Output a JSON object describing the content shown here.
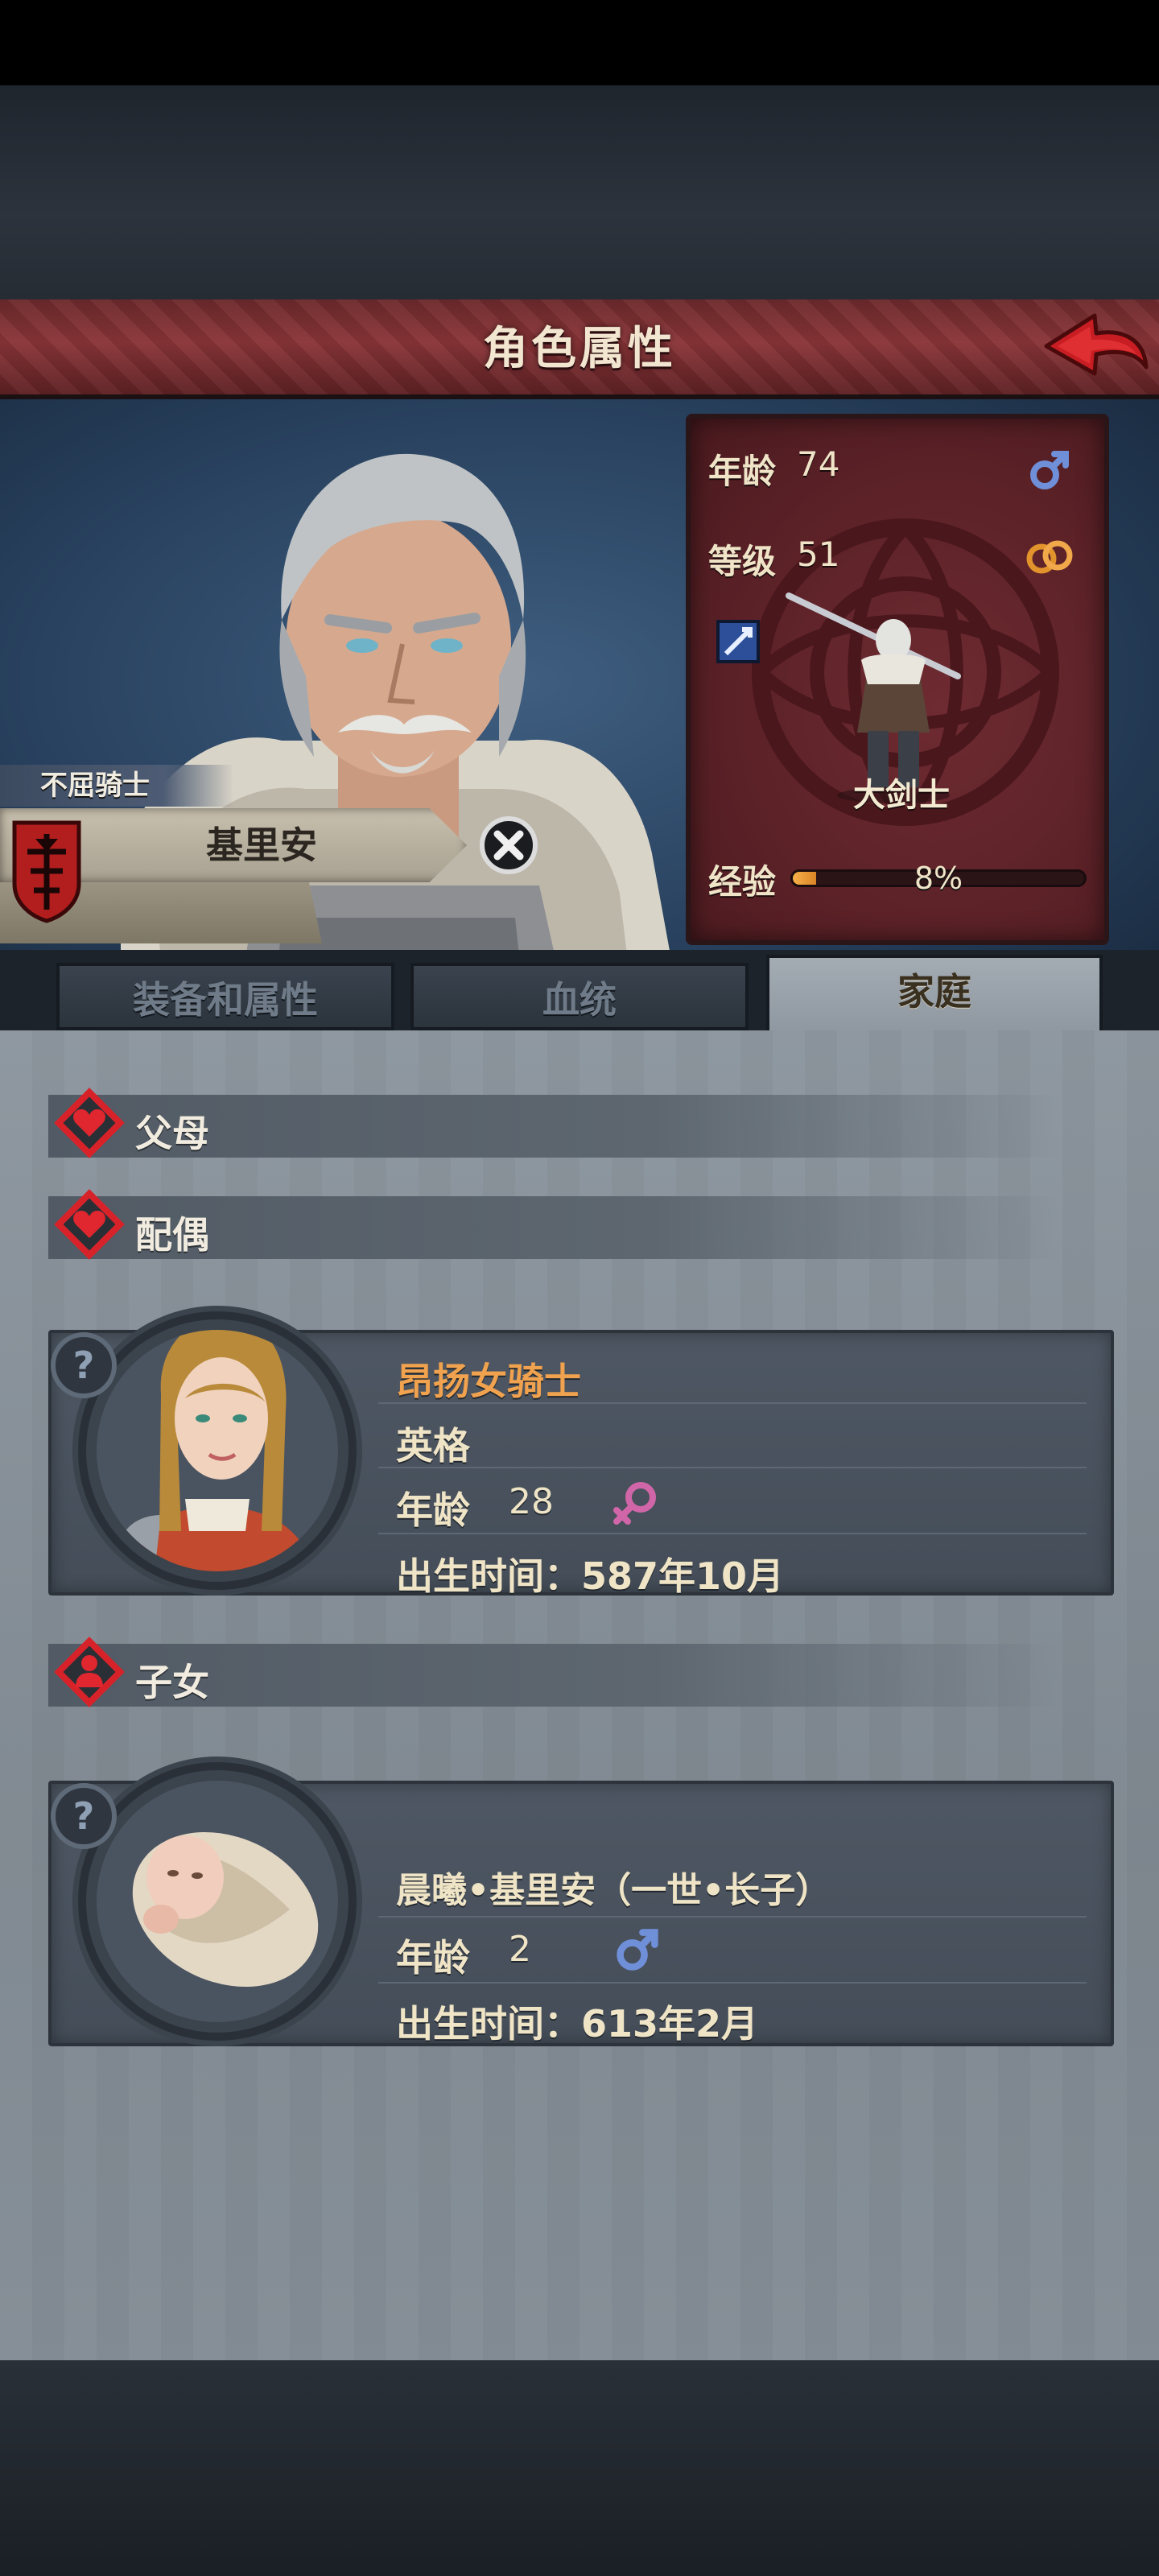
{
  "header": {
    "title": "角色属性"
  },
  "hero": {
    "class_title": "不屈骑士",
    "name": "基里安"
  },
  "stats": {
    "age_label": "年龄",
    "age_value": "74",
    "level_label": "等级",
    "level_value": "51",
    "job": "大剑士",
    "exp_label": "经验",
    "exp_text": "8%",
    "exp_fraction": 0.08,
    "gender_icon": "male-icon",
    "married_icon": "rings-icon"
  },
  "tabs": [
    {
      "label": "装备和属性",
      "active": false
    },
    {
      "label": "血统",
      "active": false
    },
    {
      "label": "家庭",
      "active": true
    }
  ],
  "family": {
    "parents_label": "父母",
    "spouse_label": "配偶",
    "children_label": "子女",
    "spouse": {
      "title": "昂扬女骑士",
      "name": "英格",
      "age_label": "年龄",
      "age_value": "28",
      "birth": "出生时间：587年10月",
      "gender_icon": "female-icon"
    },
    "child": {
      "name": "晨曦•基里安（一世•长子）",
      "age_label": "年龄",
      "age_value": "2",
      "birth": "出生时间：613年2月",
      "gender_icon": "male-icon"
    }
  },
  "colors": {
    "title_red": "#8a3538",
    "stats_panel": "#5a2127",
    "card_bg": "#4e5763",
    "accent_orange": "#f0a24e",
    "male_blue": "#6f8fd8",
    "female_pink": "#d066a8"
  }
}
